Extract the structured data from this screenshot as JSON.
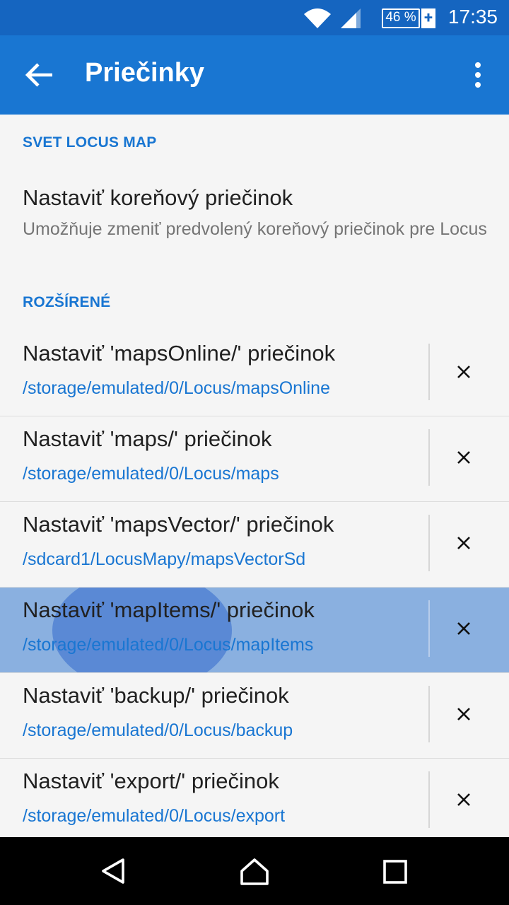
{
  "status_bar": {
    "time": "17:35",
    "battery_percent": "46 %",
    "battery_charging_symbol": "+",
    "icons": [
      "wifi-icon",
      "cellular-signal-icon",
      "battery-icon"
    ]
  },
  "app_bar": {
    "title": "Priečinky",
    "back_icon": "arrow-back-icon",
    "menu_icon": "more-vertical-icon",
    "color": "#1976d2"
  },
  "sections": {
    "svet": {
      "header": "SVET LOCUS MAP",
      "root_title": "Nastaviť koreňový priečinok",
      "root_summary": "Umožňuje zmeniť predvolený koreňový priečinok pre Locus"
    },
    "rozsirene": {
      "header": "ROZŠÍRENÉ",
      "items": [
        {
          "title": "Nastaviť 'mapsOnline/' priečinok",
          "path": "/storage/emulated/0/Locus/mapsOnline"
        },
        {
          "title": "Nastaviť 'maps/' priečinok",
          "path": "/storage/emulated/0/Locus/maps"
        },
        {
          "title": "Nastaviť 'mapsVector/' priečinok",
          "path": "/sdcard1/LocusMapy/mapsVectorSd"
        },
        {
          "title": "Nastaviť 'mapItems/' priečinok",
          "path": "/storage/emulated/0/Locus/mapItems"
        },
        {
          "title": "Nastaviť 'backup/' priečinok",
          "path": "/storage/emulated/0/Locus/backup"
        },
        {
          "title": "Nastaviť 'export/' priečinok",
          "path": "/storage/emulated/0/Locus/export"
        }
      ]
    }
  },
  "nav_bar": {
    "icons": [
      "nav-back-icon",
      "nav-home-icon",
      "nav-recents-icon"
    ]
  },
  "colors": {
    "accent": "#1976d2",
    "status_bar": "#1565c0",
    "highlight_row": "#8ab0e0"
  }
}
